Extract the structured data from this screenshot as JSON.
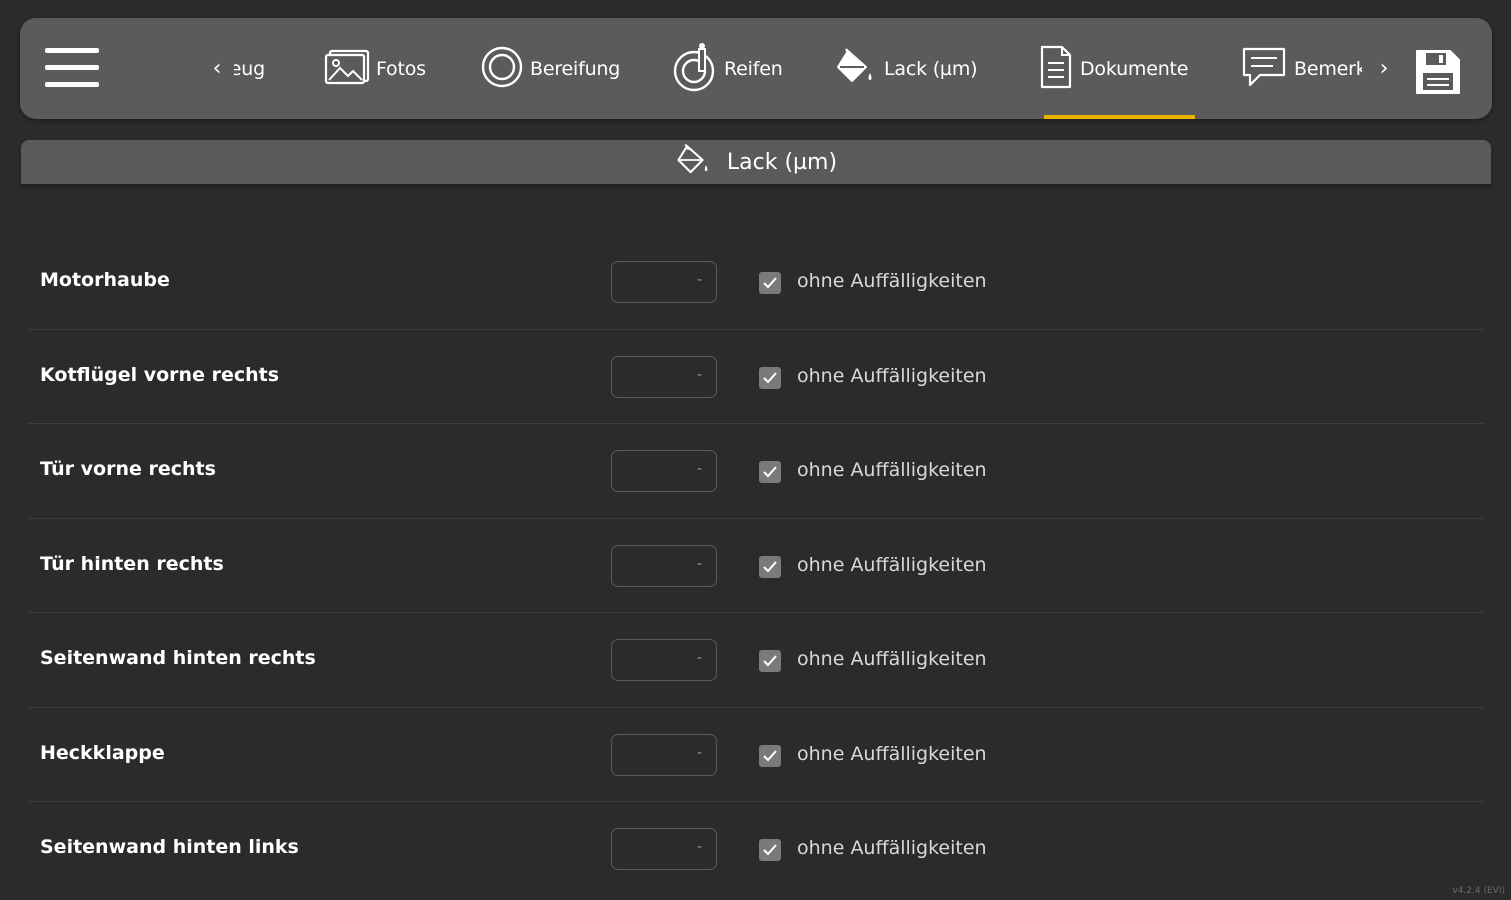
{
  "toolbar": {
    "tabs": [
      {
        "label": "zeug",
        "icon": "truncated"
      },
      {
        "label": "Fotos",
        "icon": "image-icon"
      },
      {
        "label": "Bereifung",
        "icon": "tire-ring-icon"
      },
      {
        "label": "Reifen",
        "icon": "tire-gauge-icon"
      },
      {
        "label": "Lack (µm)",
        "icon": "paint-bucket-icon",
        "active": true
      },
      {
        "label": "Dokumente",
        "icon": "document-icon"
      },
      {
        "label": "Bemerkungen",
        "icon": "comment-icon"
      }
    ],
    "prev_arrow": "‹",
    "next_arrow": "›",
    "active_color": "#e8b400"
  },
  "section": {
    "title": "Lack (µm)",
    "icon": "paint-bucket-icon"
  },
  "rows": [
    {
      "name": "Motorhaube",
      "value": "-",
      "checked": true,
      "check_label": "ohne Auffälligkeiten"
    },
    {
      "name": "Kotflügel vorne rechts",
      "value": "-",
      "checked": true,
      "check_label": "ohne Auffälligkeiten"
    },
    {
      "name": "Tür vorne rechts",
      "value": "-",
      "checked": true,
      "check_label": "ohne Auffälligkeiten"
    },
    {
      "name": "Tür hinten rechts",
      "value": "-",
      "checked": true,
      "check_label": "ohne Auffälligkeiten"
    },
    {
      "name": "Seitenwand hinten rechts",
      "value": "-",
      "checked": true,
      "check_label": "ohne Auffälligkeiten"
    },
    {
      "name": "Heckklappe",
      "value": "-",
      "checked": true,
      "check_label": "ohne Auffälligkeiten"
    },
    {
      "name": "Seitenwand hinten links",
      "value": "-",
      "checked": true,
      "check_label": "ohne Auffälligkeiten"
    }
  ],
  "footer": {
    "version": "v4.2.4 (EVI)"
  }
}
